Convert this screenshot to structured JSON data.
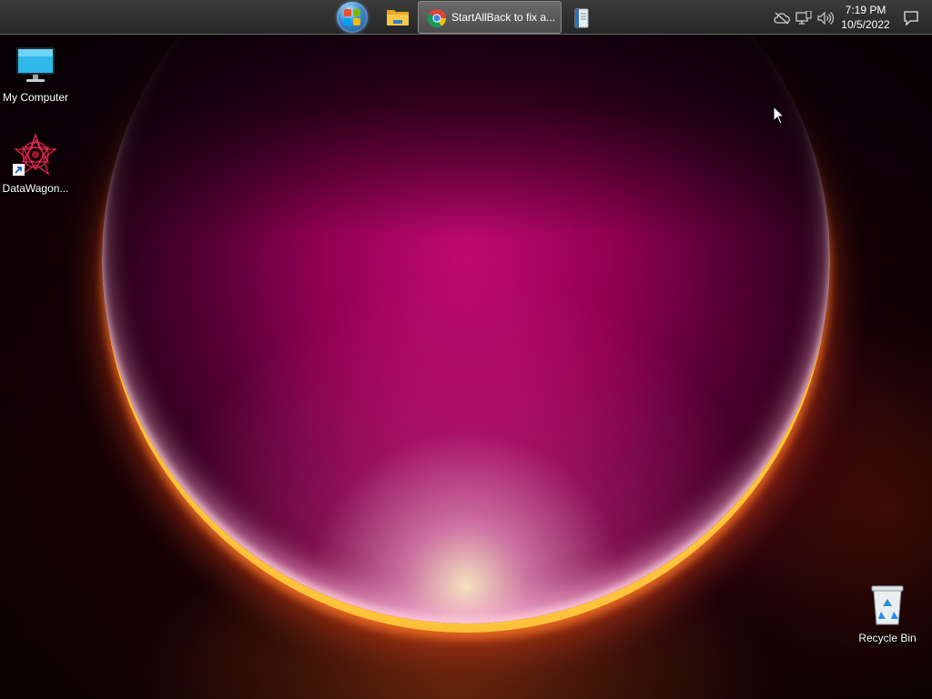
{
  "taskbar": {
    "start_icon": "windows-start-orb-icon",
    "pinned": [
      {
        "name": "file-explorer",
        "icon": "folder-icon"
      },
      {
        "name": "chrome-window",
        "icon": "chrome-icon",
        "label": "StartAllBack to fix a..."
      },
      {
        "name": "notebook",
        "icon": "notebook-icon"
      }
    ],
    "tray_icons": [
      "cloud-offline-icon",
      "network-icon",
      "volume-icon",
      "notification-icon"
    ],
    "clock": {
      "time": "7:19 PM",
      "date": "10/5/2022"
    }
  },
  "desktop": {
    "icons": [
      {
        "label": "My Computer",
        "icon": "monitor-icon"
      },
      {
        "label": "DataWagon...",
        "icon": "datawagon-icon"
      },
      {
        "label": "Recycle Bin",
        "icon": "recycle-bin-icon"
      }
    ]
  },
  "colors": {
    "taskbar_bg": "#2e2e2e",
    "wallpaper_orb": "#c0107a",
    "wallpaper_glow": "#ffc040"
  }
}
